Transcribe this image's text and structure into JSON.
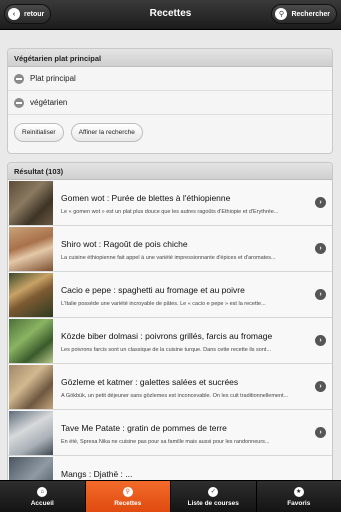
{
  "header": {
    "title": "Recettes",
    "back_label": "retour",
    "search_label": "Rechercher"
  },
  "filter": {
    "title": "Végétarien plat principal",
    "items": [
      {
        "label": "Plat principal"
      },
      {
        "label": "végétarien"
      }
    ],
    "reset_label": "Reinitialiser",
    "refine_label": "Affiner la recherche"
  },
  "results": {
    "title": "Résultat (103)",
    "items": [
      {
        "title": "Gomen wot : Purée de blettes à l'éthiopienne",
        "desc": "Le « gomen wot » est un plat plus douce que les autres ragoûts d'Éthiopie et d'Érythrée..."
      },
      {
        "title": "Shiro wot : Ragoût de pois chiche",
        "desc": "La cuisine éthiopienne fait appel à une variété impressionnante d'épices et d'aromates..."
      },
      {
        "title": "Cacio e pepe : spaghetti au fromage et au poivre",
        "desc": "L'Italie possède une variété incroyable de pâtes. Le « cacio e pepe » est la recette..."
      },
      {
        "title": "Közde biber dolmasi : poivrons grillés, farcis au fromage",
        "desc": "Les poivrons farcis sont un classique de la cuisine turque. Dans cette recette ils sont..."
      },
      {
        "title": "Gözleme et katmer : galettes salées et sucrées",
        "desc": "A Gökbük, un petit déjeuner sans gözlemes est inconcevable. On les cuit traditionnellement..."
      },
      {
        "title": "Tave Me Patate : gratin de pommes de terre",
        "desc": "En été, Spresa Nika ne cuisine pas pour sa famille mais aussi pour les randonneurs..."
      },
      {
        "title": "Mangs : Djathë : ...",
        "desc": ""
      }
    ]
  },
  "nav": {
    "tabs": [
      {
        "label": "Accueil",
        "icon": "home-icon",
        "glyph": "⌂"
      },
      {
        "label": "Recettes",
        "icon": "search-icon",
        "glyph": "⚲"
      },
      {
        "label": "Liste de courses",
        "icon": "check-icon",
        "glyph": "✓"
      },
      {
        "label": "Favoris",
        "icon": "star-icon",
        "glyph": "★"
      }
    ]
  },
  "colors": {
    "accent": "#e8561a",
    "header": "#2a2a2a"
  }
}
